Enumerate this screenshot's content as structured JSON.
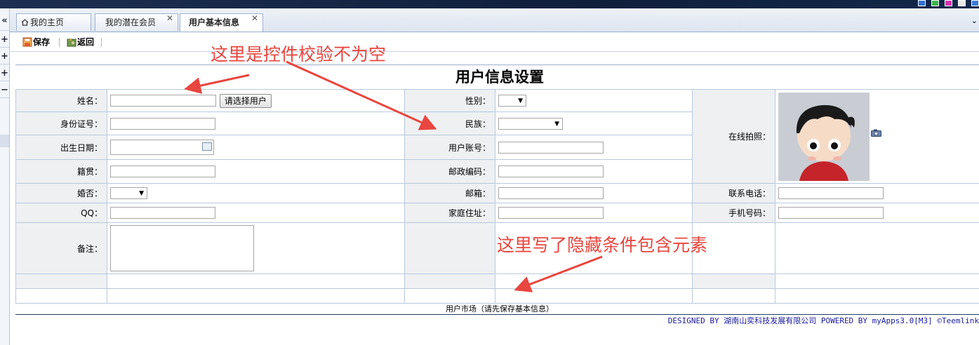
{
  "tabs": [
    {
      "label": "我的主页",
      "icon": "home-icon",
      "closable": false,
      "active": false
    },
    {
      "label": "我的潜在会员",
      "closable": true,
      "active": false
    },
    {
      "label": "用户基本信息",
      "closable": true,
      "active": true
    }
  ],
  "tab_close_glyph": "✕",
  "toolbar": {
    "save_label": "保存",
    "back_label": "返回"
  },
  "left_nav": {
    "collapse_glyph": "«",
    "buttons": [
      "+",
      "+",
      "+",
      "−"
    ]
  },
  "form": {
    "title": "用户信息设置",
    "labels": {
      "name": "姓名：",
      "gender": "性别：",
      "photo": "在线拍照：",
      "id_number": "身份证号：",
      "ethnicity": "民族：",
      "birth_date": "出生日期：",
      "account": "用户账号：",
      "native_place": "籍贯：",
      "postal_code": "邮政编码：",
      "married": "婚否：",
      "email": "邮箱：",
      "contact_phone": "联系电话：",
      "qq": "QQ：",
      "home_address": "家庭住址：",
      "mobile": "手机号码：",
      "remark": "备注："
    },
    "select_user_button": "请选择用户"
  },
  "market_text": "用户市场（请先保存基本信息）",
  "footer": "DESIGNED BY 湖南山奕科技发展有限公司 POWERED BY myApps3.0[M3] ©Teemlink",
  "annotations": [
    {
      "text": "这里是控件校验不为空"
    },
    {
      "text": "这里写了隐藏条件包含元素"
    }
  ],
  "colors": {
    "annotation_red": "#e8463f",
    "label_bg": "#eef0f2",
    "border_blue": "#b9c9dd",
    "footer_blue": "#1a1a9c",
    "topbar_navy": "#1d2f52"
  }
}
